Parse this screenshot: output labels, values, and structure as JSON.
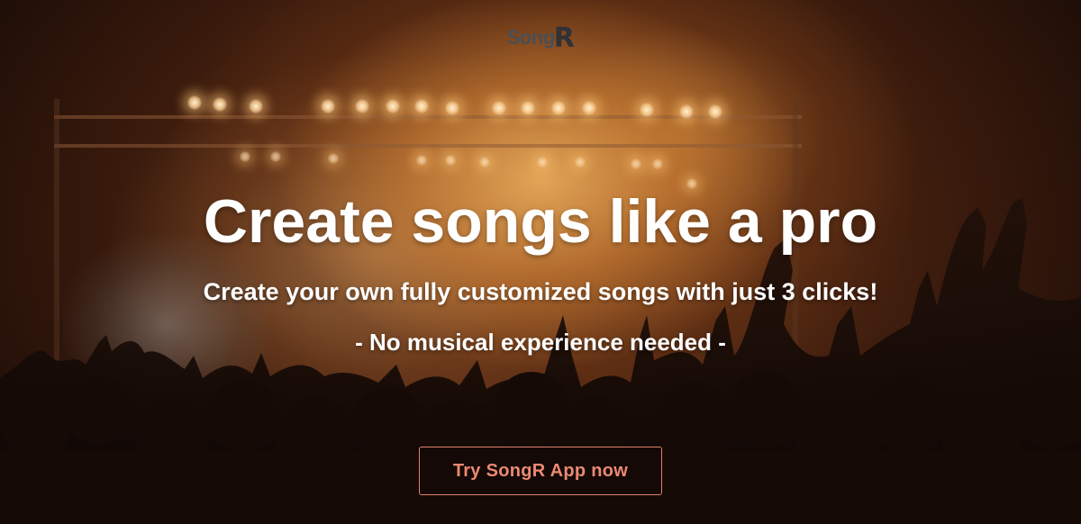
{
  "brand": {
    "name_prefix": "Song",
    "name_suffix": "R"
  },
  "hero": {
    "headline": "Create songs like a pro",
    "subheadline": "Create your own fully customized songs with just 3 clicks!",
    "tagline": "- No musical experience needed -",
    "cta_label": "Try SongR App now"
  },
  "colors": {
    "cta_accent": "#e0826a",
    "heading_text": "#ffffff",
    "logo": "#4a4e54"
  },
  "background": {
    "scene": "concert-stage-crowd-photo"
  }
}
